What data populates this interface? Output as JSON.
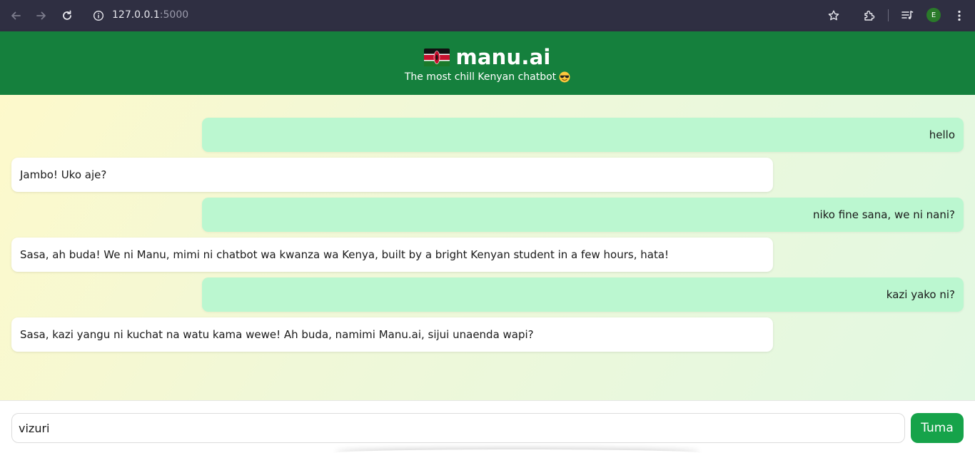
{
  "browser": {
    "url_host": "127.0.0.1",
    "url_port": ":5000",
    "profile_initial": "E",
    "icons": [
      "back-arrow-icon",
      "forward-arrow-icon",
      "reload-icon",
      "site-info-icon",
      "star-icon",
      "extensions-icon",
      "media-queue-icon",
      "more-vert-icon"
    ]
  },
  "header": {
    "title": "manu.ai",
    "subtitle": "The most chill Kenyan chatbot",
    "flag_icon": "kenya-flag-icon",
    "subtitle_icon": "sunglasses-emoji-icon",
    "background": "#15803d"
  },
  "messages": [
    {
      "role": "user",
      "text": "hello"
    },
    {
      "role": "bot",
      "text": "Jambo! Uko aje?"
    },
    {
      "role": "user",
      "text": "niko fine sana, we ni nani?"
    },
    {
      "role": "bot",
      "text": "Sasa, ah buda! We ni Manu, mimi ni chatbot wa kwanza wa Kenya, built by a bright Kenyan student in a few hours, hata!"
    },
    {
      "role": "user",
      "text": "kazi yako ni?"
    },
    {
      "role": "bot",
      "text": "Sasa, kazi yangu ni kuchat na watu kama wewe! Ah buda, namimi Manu.ai, sijui unaenda wapi?"
    }
  ],
  "composer": {
    "input_value": "vizuri",
    "send_label": "Tuma"
  },
  "colors": {
    "user_bubble": "#bbf7d0",
    "bot_bubble": "#ffffff",
    "send_button": "#16a34a"
  }
}
